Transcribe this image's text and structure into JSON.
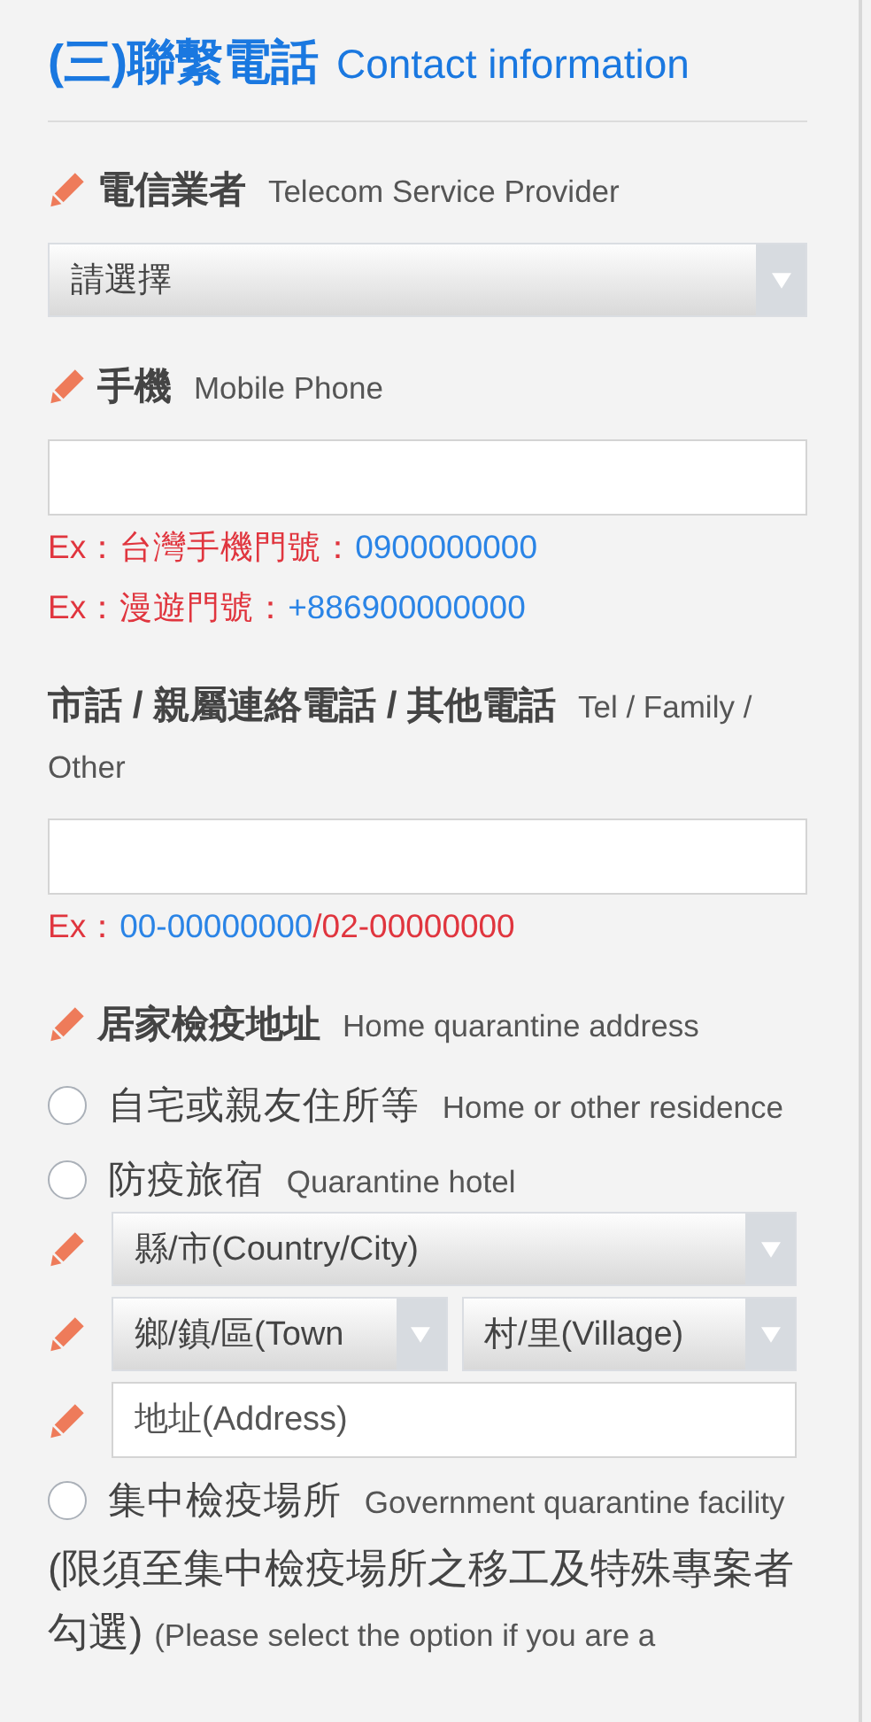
{
  "heading": {
    "zh": "(三)聯繫電話",
    "en": "Contact information"
  },
  "fields": [
    {
      "kind": "select",
      "required": true,
      "label_zh": "電信業者",
      "label_en": "Telecom Service Provider",
      "value": "請選擇"
    },
    {
      "kind": "input",
      "required": true,
      "label_zh": "手機",
      "label_en": "Mobile Phone",
      "hints": [
        [
          {
            "kind": "label",
            "text": "Ex：台灣手機門號："
          },
          {
            "kind": "example",
            "text": "0900000000"
          }
        ],
        [
          {
            "kind": "label",
            "text": "Ex：漫遊門號："
          },
          {
            "kind": "example",
            "text": "+886900000000"
          }
        ]
      ]
    },
    {
      "kind": "input",
      "required": false,
      "label_zh": "市話 / 親屬連絡電話 / 其他電話",
      "label_en": "Tel / Family / Other",
      "hints": [
        [
          {
            "kind": "label",
            "text": "Ex："
          },
          {
            "kind": "example",
            "text": "00-00000000"
          },
          {
            "kind": "label",
            "text": "/02-00000000"
          }
        ]
      ]
    }
  ],
  "address": {
    "required": true,
    "label_zh": "居家檢疫地址",
    "label_en": "Home quarantine address",
    "options": [
      {
        "zh": "自宅或親友住所等",
        "en": "Home or other residence",
        "selected": false
      },
      {
        "zh": "防疫旅宿",
        "en": "Quarantine hotel",
        "selected": false,
        "rows": [
          {
            "required": true,
            "controls": [
              {
                "kind": "select",
                "text": "縣/市(Country/City)"
              }
            ]
          },
          {
            "required": true,
            "controls": [
              {
                "kind": "select",
                "text": "鄉/鎮/區(Town"
              },
              {
                "kind": "select",
                "text": "村/里(Village)"
              }
            ]
          },
          {
            "required": true,
            "controls": [
              {
                "kind": "input",
                "placeholder": "地址(Address)"
              }
            ]
          }
        ]
      },
      {
        "zh": "集中檢疫場所",
        "en": "Government quarantine facility",
        "selected": false
      }
    ],
    "note_zh": "(限須至集中檢疫場所之移工及特殊專案者勾選)",
    "note_en": "(Please select the option if you are a"
  }
}
